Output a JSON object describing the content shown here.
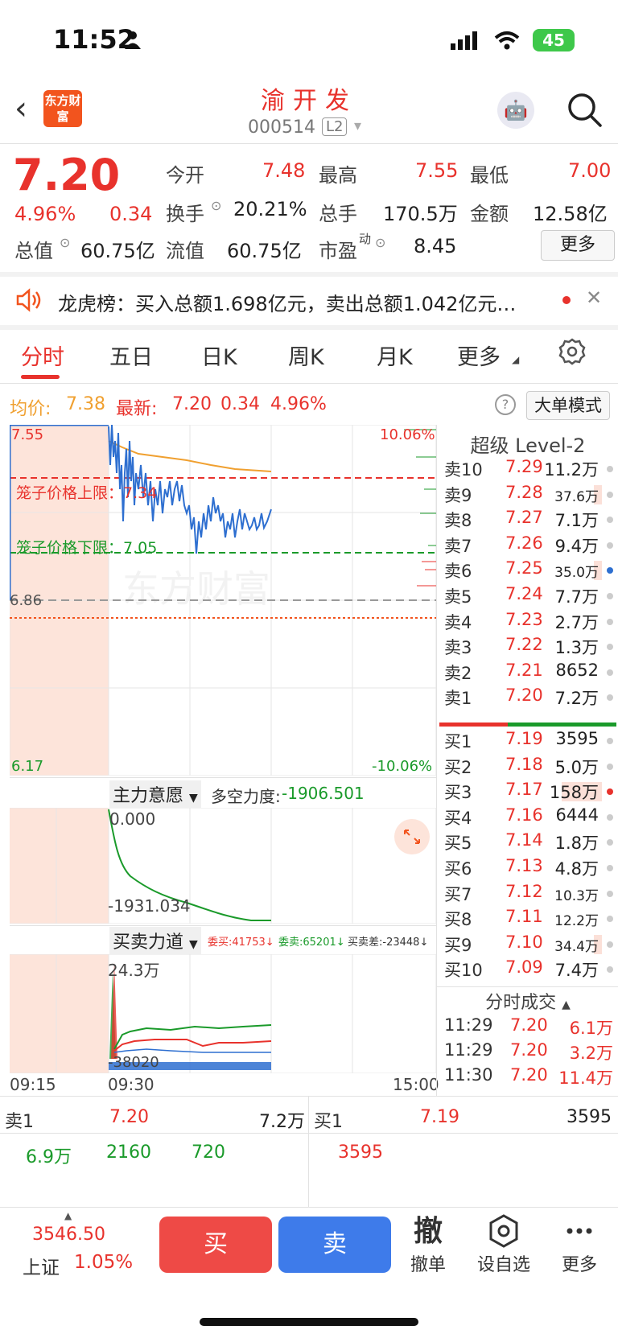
{
  "status_bar": {
    "time": "11:52",
    "battery": "45"
  },
  "header": {
    "logo": "东方财富",
    "stock_name": "渝开发",
    "stock_code": "000514",
    "level_badge": "L2"
  },
  "quote": {
    "price": "7.20",
    "pct": "4.96%",
    "chg": "0.34",
    "open_label": "今开",
    "open": "7.48",
    "high_label": "最高",
    "high": "7.55",
    "low_label": "最低",
    "low": "7.00",
    "turnover_label": "换手",
    "turnover": "20.21%",
    "volume_label": "总手",
    "volume": "170.5万",
    "amount_label": "金额",
    "amount": "12.58亿",
    "mktcap_label": "总值",
    "mktcap": "60.75亿",
    "float_label": "流值",
    "float": "60.75亿",
    "pe_label": "市盈",
    "pe_sup": "动",
    "pe": "8.45",
    "more_label": "更多"
  },
  "banner": {
    "text": "龙虎榜：买入总额1.698亿元，卖出总额1.042亿元…"
  },
  "tabs": {
    "t1": "分时",
    "t2": "五日",
    "t3": "日K",
    "t4": "周K",
    "t5": "月K",
    "t6": "更多"
  },
  "info_row": {
    "avg_label": "均价:",
    "avg": "7.38",
    "latest_label": "最新:",
    "latest": "7.20",
    "chg": "0.34",
    "pct": "4.96%",
    "big_order": "大单模式",
    "help": "?"
  },
  "main_chart": {
    "y_top": "7.55",
    "y_bottom": "6.17",
    "y_mid": "6.86",
    "pct_top": "10.06%",
    "pct_bottom": "-10.06%",
    "cage_upper_label": "笼子价格上限：7.34",
    "cage_lower_label": "笼子价格下限：7.05",
    "watermark": "东方财富"
  },
  "indicator1": {
    "selector": "主力意愿",
    "metric_label": "多空力度:",
    "metric_value": "-1906.501",
    "top_val": "0.000",
    "bottom_val": "-1931.034"
  },
  "indicator2": {
    "selector": "买卖力道",
    "buy_label": "委买:41753",
    "sell_label": "委卖:65201",
    "diff_label": "买卖差:-23448",
    "top_val": "24.3万",
    "bottom_val": "-38020"
  },
  "time_axis": {
    "start": "09:15",
    "open": "09:30",
    "end": "15:00"
  },
  "order_book": {
    "title": "超级 Level-2",
    "asks": [
      {
        "k": "卖10",
        "p": "7.29",
        "v": "11.2万",
        "small": false,
        "bar": 0
      },
      {
        "k": "卖9",
        "p": "7.28",
        "v": "37.6万",
        "small": true,
        "bar": 0.1
      },
      {
        "k": "卖8",
        "p": "7.27",
        "v": "7.1万",
        "small": false,
        "bar": 0
      },
      {
        "k": "卖7",
        "p": "7.26",
        "v": "9.4万",
        "small": false,
        "bar": 0
      },
      {
        "k": "卖6",
        "p": "7.25",
        "v": "35.0万",
        "small": true,
        "bar": 0.1,
        "dot": "blue"
      },
      {
        "k": "卖5",
        "p": "7.24",
        "v": "7.7万",
        "small": false,
        "bar": 0
      },
      {
        "k": "卖4",
        "p": "7.23",
        "v": "2.7万",
        "small": false,
        "bar": 0
      },
      {
        "k": "卖3",
        "p": "7.22",
        "v": "1.3万",
        "small": false,
        "bar": 0
      },
      {
        "k": "卖2",
        "p": "7.21",
        "v": "8652",
        "small": false,
        "bar": 0
      },
      {
        "k": "卖1",
        "p": "7.20",
        "v": "7.2万",
        "small": false,
        "bar": 0
      }
    ],
    "bids": [
      {
        "k": "买1",
        "p": "7.19",
        "v": "3595",
        "small": false,
        "bar": 0
      },
      {
        "k": "买2",
        "p": "7.18",
        "v": "5.0万",
        "small": false,
        "bar": 0
      },
      {
        "k": "买3",
        "p": "7.17",
        "v": "158万",
        "small": false,
        "bar": 0.5,
        "dot": "red"
      },
      {
        "k": "买4",
        "p": "7.16",
        "v": "6444",
        "small": false,
        "bar": 0
      },
      {
        "k": "买5",
        "p": "7.14",
        "v": "1.8万",
        "small": false,
        "bar": 0
      },
      {
        "k": "买6",
        "p": "7.13",
        "v": "4.8万",
        "small": false,
        "bar": 0
      },
      {
        "k": "买7",
        "p": "7.12",
        "v": "10.3万",
        "small": true,
        "bar": 0
      },
      {
        "k": "买8",
        "p": "7.11",
        "v": "12.2万",
        "small": true,
        "bar": 0
      },
      {
        "k": "买9",
        "p": "7.10",
        "v": "34.4万",
        "small": true,
        "bar": 0.1
      },
      {
        "k": "买10",
        "p": "7.09",
        "v": "7.4万",
        "small": false,
        "bar": 0
      }
    ],
    "trades_title": "分时成交",
    "trades": [
      {
        "t": "11:29",
        "p": "7.20",
        "v": "6.1万"
      },
      {
        "t": "11:29",
        "p": "7.20",
        "v": "3.2万"
      },
      {
        "t": "11:30",
        "p": "7.20",
        "v": "11.4万"
      }
    ]
  },
  "bottom_quote": {
    "sell_label": "卖1",
    "sell_price": "7.20",
    "sell_vol": "7.2万",
    "buy_label": "买1",
    "buy_price": "7.19",
    "buy_vol": "3595",
    "sell_detail": [
      "6.9万",
      "2160",
      "720"
    ],
    "buy_detail": [
      "3595"
    ]
  },
  "bottom_bar": {
    "index_price": "3546.50",
    "index_name": "上证",
    "index_pct": "1.05%",
    "buy": "买",
    "sell": "卖",
    "cancel_icon": "撤",
    "cancel": "撤单",
    "watch": "设自选",
    "more": "更多"
  },
  "colors": {
    "up": "#e8322c",
    "down": "#1a9a2a",
    "brand": "#f2541e",
    "blue_line": "#2e6fd0"
  },
  "icons": [
    "back-icon",
    "search-icon",
    "robot-icon",
    "speaker-icon",
    "close-icon",
    "settings-icon",
    "help-icon",
    "expand-icon",
    "hexagon-icon",
    "dots-icon"
  ]
}
